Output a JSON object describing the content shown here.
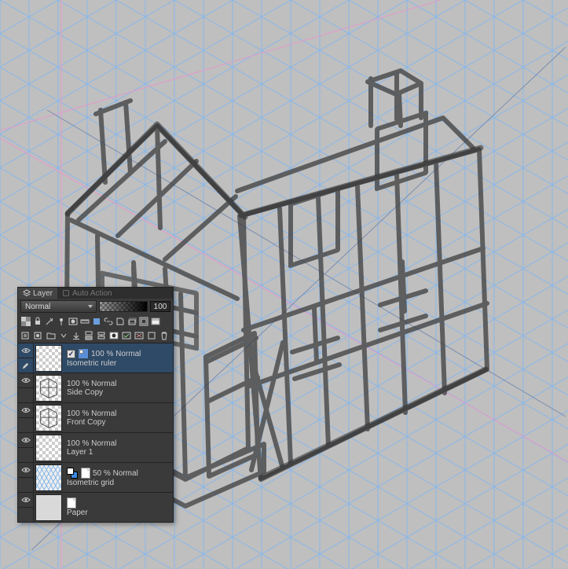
{
  "tabs": {
    "layer": "Layer",
    "autoAction": "Auto Action"
  },
  "blend": {
    "mode": "Normal",
    "opacity": "100"
  },
  "layers": [
    {
      "id": "isometric_ruler",
      "visible": true,
      "editing": true,
      "selected": true,
      "checkbox": true,
      "icon": "ruler",
      "opacity": "100 % Normal",
      "name": "Isometric ruler",
      "thumb": "checker"
    },
    {
      "id": "side_copy",
      "visible": true,
      "opacity": "100 % Normal",
      "name": "Side Copy",
      "thumb": "sketch"
    },
    {
      "id": "front_copy",
      "visible": true,
      "opacity": "100 % Normal",
      "name": "Front Copy",
      "thumb": "sketch"
    },
    {
      "id": "layer_1",
      "visible": true,
      "opacity": "100 % Normal",
      "name": "Layer 1",
      "thumb": "checker"
    },
    {
      "id": "isometric_grid",
      "visible": true,
      "icon": "page",
      "colorchip": true,
      "opacity": "50 % Normal",
      "name": "Isometric grid",
      "thumb": "iso"
    },
    {
      "id": "paper",
      "visible": true,
      "icon": "page",
      "opacity": "",
      "name": "Paper",
      "thumb": "solid"
    }
  ]
}
